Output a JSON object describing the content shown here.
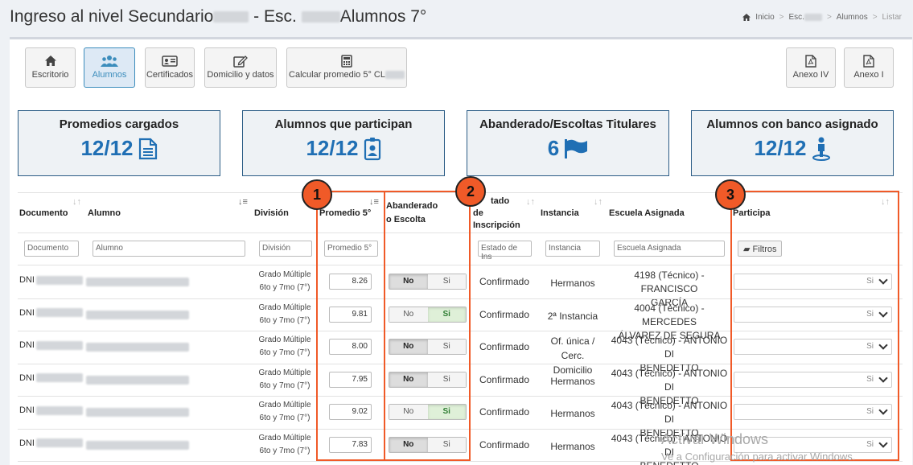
{
  "header": {
    "title_part1": "Ingreso al nivel Secundario",
    "title_part2": "- Esc.",
    "title_part3": "Alumnos 7°",
    "breadcrumb": [
      "Inicio",
      "Esc.",
      "Alumnos",
      "Listar"
    ]
  },
  "toolbar": {
    "left": [
      {
        "label": "Escritorio",
        "icon": "home-icon"
      },
      {
        "label": "Alumnos",
        "icon": "users-icon"
      },
      {
        "label": "Certificados",
        "icon": "id-card-icon"
      },
      {
        "label": "Domicilio y datos",
        "icon": "edit-icon"
      },
      {
        "label": "Calcular promedio 5° CL",
        "icon": "calculator-icon"
      }
    ],
    "right": [
      {
        "label": "Anexo IV",
        "icon": "pdf-icon"
      },
      {
        "label": "Anexo I",
        "icon": "pdf-icon"
      }
    ]
  },
  "stats": [
    {
      "title": "Promedios cargados",
      "value": "12/12",
      "icon": "document-icon"
    },
    {
      "title": "Alumnos que participan",
      "value": "12/12",
      "icon": "badge-icon"
    },
    {
      "title": "Abanderado/Escoltas Titulares",
      "value": "6",
      "icon": "flag-icon"
    },
    {
      "title": "Alumnos con banco asignado",
      "value": "12/12",
      "icon": "person-pin-icon"
    }
  ],
  "table": {
    "headers": {
      "documento": "Documento",
      "alumno": "Alumno",
      "division": "División",
      "promedio": "Promedio 5°",
      "abanderado_1": "Abanderado",
      "abanderado_2": "o Escolta",
      "estado_1": "tado",
      "estado_2": "de",
      "estado_3": "Inscripción",
      "instancia": "Instancia",
      "escuela": "Escuela Asignada",
      "participa": "Participa"
    },
    "filters": {
      "documento": "Documento",
      "alumno": "Alumno",
      "division": "División",
      "promedio": "Promedio 5°",
      "estado": "Estado de Ins",
      "instancia": "Instancia",
      "escuela": "Escuela Asignada",
      "filtros_btn": "Filtros"
    },
    "toggle_no": "No",
    "toggle_si": "Si",
    "rows": [
      {
        "doc": "DNI",
        "div1": "Grado Múltiple",
        "div2": "6to y 7mo (7°)",
        "promedio": "8.26",
        "abanderado": "No",
        "estado": "Confirmado",
        "inst1": "Hermanos",
        "inst2": "",
        "esc1": "4198 (Técnico) - FRANCISCO",
        "esc2": "GARCÍA",
        "participa": "Si"
      },
      {
        "doc": "DNI",
        "div1": "Grado Múltiple",
        "div2": "6to y 7mo (7°)",
        "promedio": "9.81",
        "abanderado": "Si",
        "estado": "Confirmado",
        "inst1": "2ª Instancia",
        "inst2": "",
        "esc1": "4004 (Técnico) - MERCEDES",
        "esc2": "ÁLVAREZ DE SEGURA",
        "participa": "Si"
      },
      {
        "doc": "DNI",
        "div1": "Grado Múltiple",
        "div2": "6to y 7mo (7°)",
        "promedio": "8.00",
        "abanderado": "No",
        "estado": "Confirmado",
        "inst1": "Of. única /",
        "inst2": "Cerc. Domicilio",
        "esc1": "4043 (Técnico) - ANTONIO DI",
        "esc2": "BENEDETTO",
        "participa": "Si"
      },
      {
        "doc": "DNI",
        "div1": "Grado Múltiple",
        "div2": "6to y 7mo (7°)",
        "promedio": "7.95",
        "abanderado": "No",
        "estado": "Confirmado",
        "inst1": "Hermanos",
        "inst2": "",
        "esc1": "4043 (Técnico) - ANTONIO DI",
        "esc2": "BENEDETTO",
        "participa": "Si"
      },
      {
        "doc": "DNI",
        "div1": "Grado Múltiple",
        "div2": "6to y 7mo (7°)",
        "promedio": "9.02",
        "abanderado": "Si",
        "estado": "Confirmado",
        "inst1": "Hermanos",
        "inst2": "",
        "esc1": "4043 (Técnico) - ANTONIO DI",
        "esc2": "BENEDETTO",
        "participa": "Si"
      },
      {
        "doc": "DNI",
        "div1": "Grado Múltiple",
        "div2": "6to y 7mo (7°)",
        "promedio": "7.83",
        "abanderado": "No",
        "estado": "Confirmado",
        "inst1": "Hermanos",
        "inst2": "",
        "esc1": "4043 (Técnico) - ANTONIO DI",
        "esc2": "BENEDETTO",
        "participa": "Si"
      }
    ]
  },
  "annotations": [
    "1",
    "2",
    "3"
  ],
  "watermark": {
    "line1": "Activar Windows",
    "line2": "Ve a Configuración para activar Windows."
  },
  "colors": {
    "accent": "#1f6fb4",
    "highlight": "#f05a28",
    "stat_border": "#2c5d86"
  }
}
